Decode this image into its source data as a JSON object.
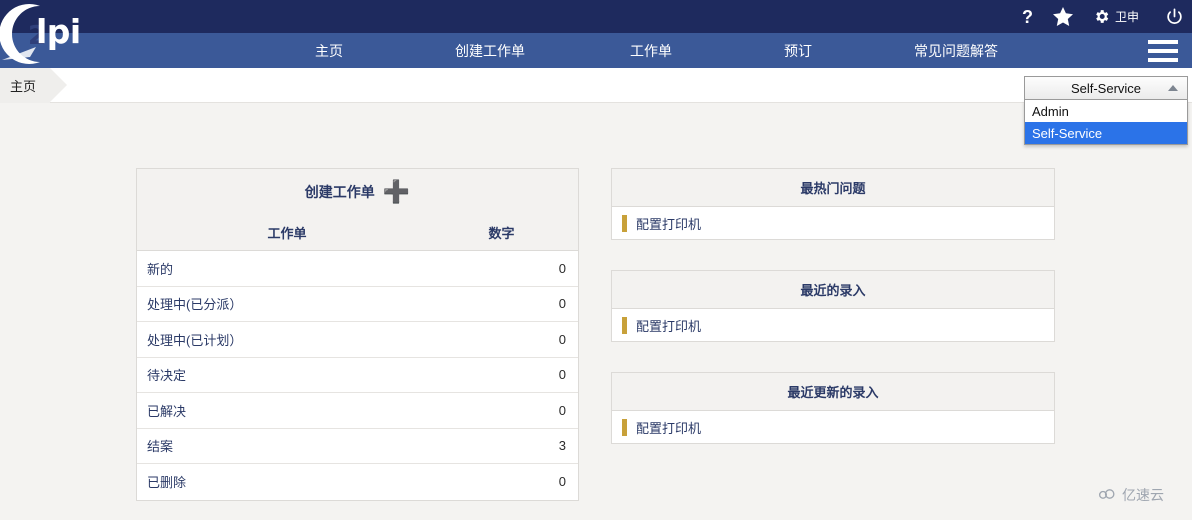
{
  "app": {
    "logo_text": "lpi",
    "logo_icon": "glpi-logo-icon"
  },
  "topbar": {
    "help_icon": "question-mark-icon",
    "favorites_icon": "star-icon",
    "settings_icon": "gear-icon",
    "user_name": "卫申",
    "logout_icon": "power-icon",
    "background": "#1e2a5e"
  },
  "nav": {
    "background": "#3b5998",
    "menu_icon": "hamburger-menu-icon",
    "items": [
      {
        "label": "主页"
      },
      {
        "label": "创建工作单"
      },
      {
        "label": "工作单"
      },
      {
        "label": "预订"
      },
      {
        "label": "常见问题解答"
      }
    ]
  },
  "breadcrumb": {
    "items": [
      {
        "label": "主页"
      }
    ]
  },
  "profile_select": {
    "value": "Self-Service",
    "caret_icon": "chevron-up-icon",
    "expanded": true,
    "options": [
      {
        "label": "Admin",
        "selected": false
      },
      {
        "label": "Self-Service",
        "selected": true
      }
    ],
    "highlight_color": "#2b73e8"
  },
  "ticket_panel": {
    "title": "创建工作单",
    "add_icon": "plus-icon",
    "columns": [
      "工作单",
      "数字"
    ],
    "rows": [
      {
        "label": "新的",
        "count": "0"
      },
      {
        "label": "处理中(已分派）",
        "count": "0"
      },
      {
        "label": "处理中(已计划）",
        "count": "0"
      },
      {
        "label": "待决定",
        "count": "0"
      },
      {
        "label": "已解决",
        "count": "0"
      },
      {
        "label": "结案",
        "count": "3"
      },
      {
        "label": "已删除",
        "count": "0"
      }
    ]
  },
  "panels": [
    {
      "title": "最热门问题",
      "items": [
        {
          "label": "配置打印机",
          "marker_color": "#c8a13a"
        }
      ]
    },
    {
      "title": "最近的录入",
      "items": [
        {
          "label": "配置打印机",
          "marker_color": "#c8a13a"
        }
      ]
    },
    {
      "title": "最近更新的录入",
      "items": [
        {
          "label": "配置打印机",
          "marker_color": "#c8a13a"
        }
      ]
    }
  ],
  "watermark": {
    "icon": "cloud-icon",
    "text": "亿速云"
  }
}
